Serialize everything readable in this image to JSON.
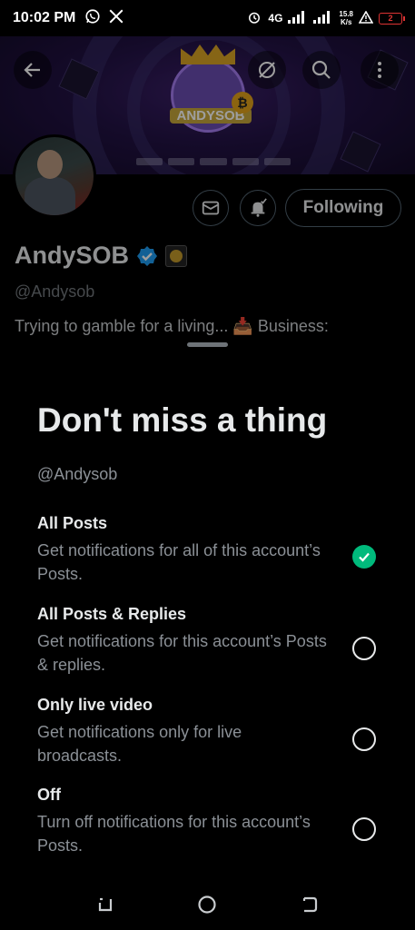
{
  "status_bar": {
    "time": "10:02 PM",
    "icons": [
      "whatsapp-icon",
      "x-icon"
    ],
    "network": "4G",
    "speed_value": "15.8",
    "speed_unit": "K/s",
    "battery": "2"
  },
  "header": {
    "back_icon": "arrow-left-icon",
    "grok_icon": "grok-icon",
    "search_icon": "search-icon",
    "more_icon": "more-vertical-icon"
  },
  "banner": {
    "logo_text": "ANDYSOB",
    "coin_symbol": "₿"
  },
  "profile": {
    "display_name": "AndySOB",
    "handle": "@Andysob",
    "bio": "Trying to gamble for a living... 📥 Business:",
    "follow_label": "Following"
  },
  "sheet": {
    "title": "Don't miss a thing",
    "handle": "@Andysob",
    "options": [
      {
        "title": "All Posts",
        "description": "Get notifications for all of this account’s Posts.",
        "selected": true
      },
      {
        "title": "All Posts & Replies",
        "description": "Get notifications for this account’s Posts & replies.",
        "selected": false
      },
      {
        "title": "Only live video",
        "description": "Get notifications only for live broadcasts.",
        "selected": false
      },
      {
        "title": "Off",
        "description": "Turn off notifications for this account’s Posts.",
        "selected": false
      }
    ]
  },
  "colors": {
    "accent_green": "#00ba7c",
    "verified_blue": "#1d9bf0",
    "banner_purple": "#3a1f66"
  }
}
